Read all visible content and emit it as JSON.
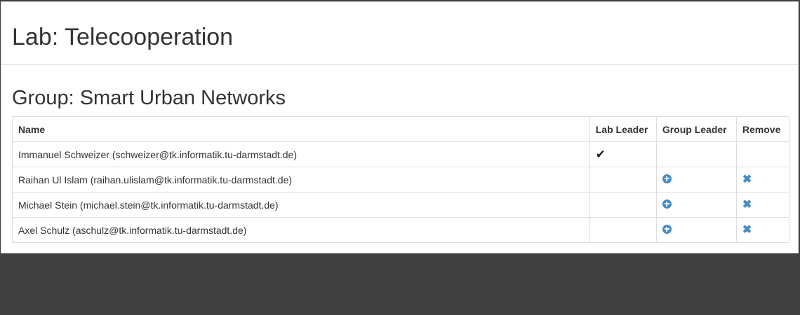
{
  "lab_title": "Lab: Telecooperation",
  "group_title": "Group: Smart Urban Networks",
  "table": {
    "headers": {
      "name": "Name",
      "lab_leader": "Lab Leader",
      "group_leader": "Group Leader",
      "remove": "Remove"
    },
    "rows": [
      {
        "name": "Immanuel Schweizer (schweizer@tk.informatik.tu-darmstadt.de)",
        "lab_leader": true,
        "group_leader_action": false,
        "remove_action": false
      },
      {
        "name": "Raihan Ul Islam (raihan.ulislam@tk.informatik.tu-darmstadt.de)",
        "lab_leader": false,
        "group_leader_action": true,
        "remove_action": true
      },
      {
        "name": "Michael Stein (michael.stein@tk.informatik.tu-darmstadt.de)",
        "lab_leader": false,
        "group_leader_action": true,
        "remove_action": true
      },
      {
        "name": "Axel Schulz (aschulz@tk.informatik.tu-darmstadt.de)",
        "lab_leader": false,
        "group_leader_action": true,
        "remove_action": true
      }
    ]
  },
  "icons": {
    "check": "check-icon",
    "add_group_leader": "plus-circle-icon",
    "remove": "remove-x-icon"
  },
  "colors": {
    "icon_blue": "#428bca",
    "footer_bg": "#404040",
    "border": "#dddddd"
  }
}
